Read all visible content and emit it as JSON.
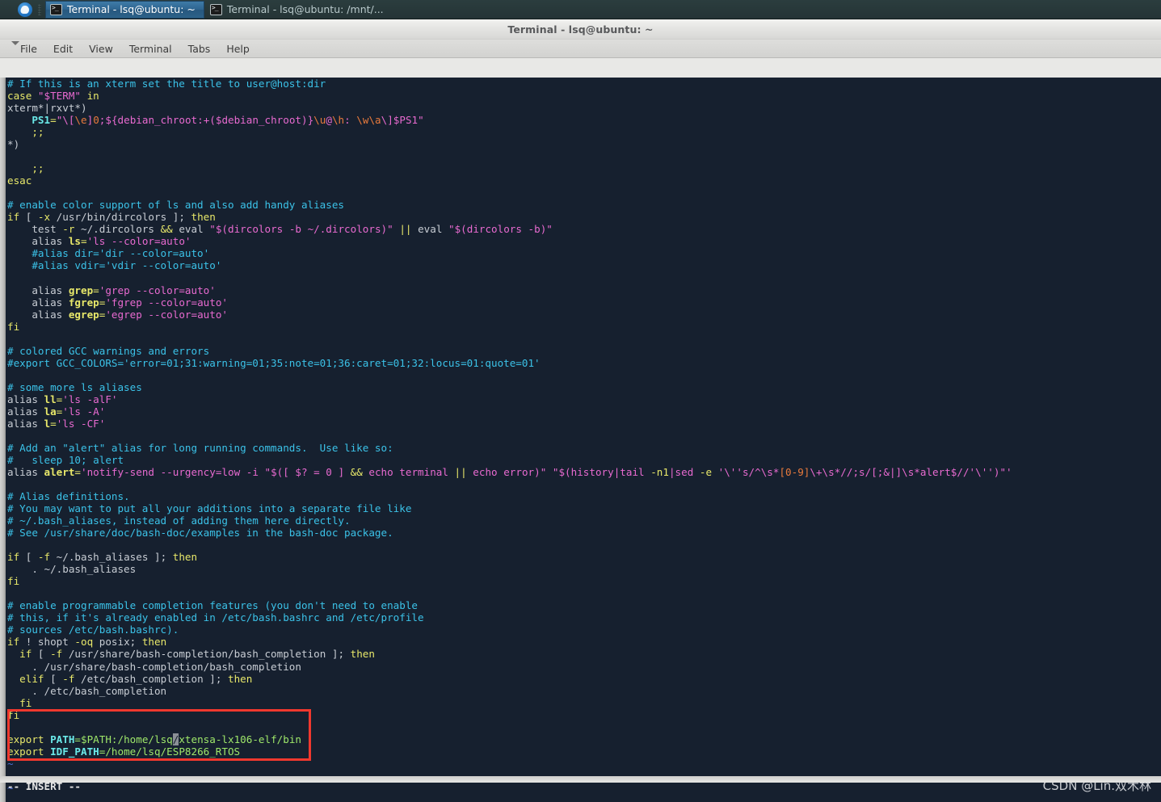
{
  "taskbar": {
    "launcher_icon": "ubuntu-launcher-icon",
    "handle_icon": "panel-drag-handle-icon",
    "tasks": [
      {
        "label": "Terminal - lsq@ubuntu: ~",
        "icon": "terminal-icon",
        "active": true
      },
      {
        "label": "Terminal - lsq@ubuntu: /mnt/...",
        "icon": "terminal-icon",
        "active": false
      }
    ]
  },
  "window": {
    "title": "Terminal - lsq@ubuntu: ~",
    "menu_caret_icon": "chevron-down-icon",
    "menu": [
      {
        "label": "File"
      },
      {
        "label": "Edit"
      },
      {
        "label": "View"
      },
      {
        "label": "Terminal"
      },
      {
        "label": "Tabs"
      },
      {
        "label": "Help"
      }
    ]
  },
  "terminal": {
    "status_line": "-- INSERT --",
    "watermark": "CSDN @Lin.双木林",
    "cursor_char": "/",
    "colors": {
      "background": "#16202f",
      "comment": "#3bc2e8",
      "statement": "#e8e86a",
      "string": "#e86ad0",
      "constant": "#e87a3c",
      "identifier": "#6ae8e8",
      "normal": "#c8cdd4",
      "tilde": "#4b6fd4",
      "annotation": "#f0382e",
      "cursor": "#8b8f96"
    },
    "lines": [
      [
        {
          "t": "# If this is an xterm set the title to user@host:dir",
          "c": "c-comment"
        }
      ],
      [
        {
          "t": "case ",
          "c": "c-stmt"
        },
        {
          "t": "\"$TERM\"",
          "c": "c-string"
        },
        {
          "t": " in",
          "c": "c-stmt"
        }
      ],
      [
        {
          "t": "xterm*|rxvt*)",
          "c": "c-ident"
        }
      ],
      [
        {
          "t": "    ",
          "c": "c-ident"
        },
        {
          "t": "PS1",
          "c": "c-var"
        },
        {
          "t": "=",
          "c": "c-op"
        },
        {
          "t": "\"\\[",
          "c": "c-string"
        },
        {
          "t": "\\e",
          "c": "c-special"
        },
        {
          "t": "]",
          "c": "c-string"
        },
        {
          "t": "0",
          "c": "c-const"
        },
        {
          "t": ";${debian_chroot:+($debian_chroot)}",
          "c": "c-string"
        },
        {
          "t": "\\u",
          "c": "c-special"
        },
        {
          "t": "@",
          "c": "c-string"
        },
        {
          "t": "\\h",
          "c": "c-special"
        },
        {
          "t": ": ",
          "c": "c-string"
        },
        {
          "t": "\\w",
          "c": "c-special"
        },
        {
          "t": "\\a",
          "c": "c-special"
        },
        {
          "t": "\\]",
          "c": "c-string"
        },
        {
          "t": "$PS1\"",
          "c": "c-string"
        }
      ],
      [
        {
          "t": "    ;;",
          "c": "c-stmt"
        }
      ],
      [
        {
          "t": "*)",
          "c": "c-ident"
        }
      ],
      [
        {
          "t": "",
          "c": "c-ident"
        }
      ],
      [
        {
          "t": "    ;;",
          "c": "c-stmt"
        }
      ],
      [
        {
          "t": "esac",
          "c": "c-stmt"
        }
      ],
      [
        {
          "t": "",
          "c": "c-ident"
        }
      ],
      [
        {
          "t": "# enable color support of ls and also add handy aliases",
          "c": "c-comment"
        }
      ],
      [
        {
          "t": "if",
          "c": "c-stmt"
        },
        {
          "t": " [ ",
          "c": "c-ident"
        },
        {
          "t": "-x",
          "c": "c-stmt"
        },
        {
          "t": " /usr/bin/dircolors ]; ",
          "c": "c-ident"
        },
        {
          "t": "then",
          "c": "c-stmt"
        }
      ],
      [
        {
          "t": "    test ",
          "c": "c-ident"
        },
        {
          "t": "-r",
          "c": "c-stmt"
        },
        {
          "t": " ~/.dircolors ",
          "c": "c-ident"
        },
        {
          "t": "&&",
          "c": "c-op"
        },
        {
          "t": " eval ",
          "c": "c-ident"
        },
        {
          "t": "\"$(dircolors -b ~/.dircolors)\"",
          "c": "c-string"
        },
        {
          "t": " ",
          "c": "c-ident"
        },
        {
          "t": "||",
          "c": "c-op"
        },
        {
          "t": " eval ",
          "c": "c-ident"
        },
        {
          "t": "\"$(dircolors -b)\"",
          "c": "c-string"
        }
      ],
      [
        {
          "t": "    alias ",
          "c": "c-ident"
        },
        {
          "t": "ls",
          "c": "c-func"
        },
        {
          "t": "=",
          "c": "c-op"
        },
        {
          "t": "'ls --color=auto'",
          "c": "c-string"
        }
      ],
      [
        {
          "t": "    #alias dir='dir --color=auto'",
          "c": "c-comment"
        }
      ],
      [
        {
          "t": "    #alias vdir='vdir --color=auto'",
          "c": "c-comment"
        }
      ],
      [
        {
          "t": "",
          "c": "c-ident"
        }
      ],
      [
        {
          "t": "    alias ",
          "c": "c-ident"
        },
        {
          "t": "grep",
          "c": "c-func"
        },
        {
          "t": "=",
          "c": "c-op"
        },
        {
          "t": "'grep --color=auto'",
          "c": "c-string"
        }
      ],
      [
        {
          "t": "    alias ",
          "c": "c-ident"
        },
        {
          "t": "fgrep",
          "c": "c-func"
        },
        {
          "t": "=",
          "c": "c-op"
        },
        {
          "t": "'fgrep --color=auto'",
          "c": "c-string"
        }
      ],
      [
        {
          "t": "    alias ",
          "c": "c-ident"
        },
        {
          "t": "egrep",
          "c": "c-func"
        },
        {
          "t": "=",
          "c": "c-op"
        },
        {
          "t": "'egrep --color=auto'",
          "c": "c-string"
        }
      ],
      [
        {
          "t": "fi",
          "c": "c-stmt"
        }
      ],
      [
        {
          "t": "",
          "c": "c-ident"
        }
      ],
      [
        {
          "t": "# colored GCC warnings and errors",
          "c": "c-comment"
        }
      ],
      [
        {
          "t": "#export GCC_COLORS='error=01;31:warning=01;35:note=01;36:caret=01;32:locus=01:quote=01'",
          "c": "c-comment"
        }
      ],
      [
        {
          "t": "",
          "c": "c-ident"
        }
      ],
      [
        {
          "t": "# some more ls aliases",
          "c": "c-comment"
        }
      ],
      [
        {
          "t": "alias ",
          "c": "c-ident"
        },
        {
          "t": "ll",
          "c": "c-func"
        },
        {
          "t": "=",
          "c": "c-op"
        },
        {
          "t": "'ls -alF'",
          "c": "c-string"
        }
      ],
      [
        {
          "t": "alias ",
          "c": "c-ident"
        },
        {
          "t": "la",
          "c": "c-func"
        },
        {
          "t": "=",
          "c": "c-op"
        },
        {
          "t": "'ls -A'",
          "c": "c-string"
        }
      ],
      [
        {
          "t": "alias ",
          "c": "c-ident"
        },
        {
          "t": "l",
          "c": "c-func"
        },
        {
          "t": "=",
          "c": "c-op"
        },
        {
          "t": "'ls -CF'",
          "c": "c-string"
        }
      ],
      [
        {
          "t": "",
          "c": "c-ident"
        }
      ],
      [
        {
          "t": "# Add an \"alert\" alias for long running commands.  Use like so:",
          "c": "c-comment"
        }
      ],
      [
        {
          "t": "#   sleep 10; alert",
          "c": "c-comment"
        }
      ],
      [
        {
          "t": "alias ",
          "c": "c-ident"
        },
        {
          "t": "alert",
          "c": "c-func"
        },
        {
          "t": "=",
          "c": "c-op"
        },
        {
          "t": "'notify-send --urgency=low -i ",
          "c": "c-string"
        },
        {
          "t": "\"$([ $? = 0 ] ",
          "c": "c-string"
        },
        {
          "t": "&&",
          "c": "c-op"
        },
        {
          "t": " echo terminal ",
          "c": "c-string"
        },
        {
          "t": "||",
          "c": "c-op"
        },
        {
          "t": " echo error)\"",
          "c": "c-string"
        },
        {
          "t": " ",
          "c": "c-ident"
        },
        {
          "t": "\"$(history|tail ",
          "c": "c-string"
        },
        {
          "t": "-n1",
          "c": "c-stmt"
        },
        {
          "t": "|sed ",
          "c": "c-string"
        },
        {
          "t": "-e",
          "c": "c-stmt"
        },
        {
          "t": " '\\''s/^\\s*",
          "c": "c-string"
        },
        {
          "t": "[0-9]",
          "c": "c-const"
        },
        {
          "t": "\\+\\s*//;s/[;&|]\\s*alert$//'\\''",
          "c": "c-string"
        },
        {
          "t": ")\"'",
          "c": "c-string"
        }
      ],
      [
        {
          "t": "",
          "c": "c-ident"
        }
      ],
      [
        {
          "t": "# Alias definitions.",
          "c": "c-comment"
        }
      ],
      [
        {
          "t": "# You may want to put all your additions into a separate file like",
          "c": "c-comment"
        }
      ],
      [
        {
          "t": "# ~/.bash_aliases, instead of adding them here directly.",
          "c": "c-comment"
        }
      ],
      [
        {
          "t": "# See /usr/share/doc/bash-doc/examples in the bash-doc package.",
          "c": "c-comment"
        }
      ],
      [
        {
          "t": "",
          "c": "c-ident"
        }
      ],
      [
        {
          "t": "if",
          "c": "c-stmt"
        },
        {
          "t": " [ ",
          "c": "c-ident"
        },
        {
          "t": "-f",
          "c": "c-stmt"
        },
        {
          "t": " ~/.bash_aliases ]; ",
          "c": "c-ident"
        },
        {
          "t": "then",
          "c": "c-stmt"
        }
      ],
      [
        {
          "t": "    . ~/.bash_aliases",
          "c": "c-ident"
        }
      ],
      [
        {
          "t": "fi",
          "c": "c-stmt"
        }
      ],
      [
        {
          "t": "",
          "c": "c-ident"
        }
      ],
      [
        {
          "t": "# enable programmable completion features (you don't need to enable",
          "c": "c-comment"
        }
      ],
      [
        {
          "t": "# this, if it's already enabled in /etc/bash.bashrc and /etc/profile",
          "c": "c-comment"
        }
      ],
      [
        {
          "t": "# sources /etc/bash.bashrc).",
          "c": "c-comment"
        }
      ],
      [
        {
          "t": "if",
          "c": "c-stmt"
        },
        {
          "t": " ! shopt ",
          "c": "c-ident"
        },
        {
          "t": "-oq",
          "c": "c-stmt"
        },
        {
          "t": " posix; ",
          "c": "c-ident"
        },
        {
          "t": "then",
          "c": "c-stmt"
        }
      ],
      [
        {
          "t": "  ",
          "c": "c-ident"
        },
        {
          "t": "if",
          "c": "c-stmt"
        },
        {
          "t": " [ ",
          "c": "c-ident"
        },
        {
          "t": "-f",
          "c": "c-stmt"
        },
        {
          "t": " /usr/share/bash-completion/bash_completion ]; ",
          "c": "c-ident"
        },
        {
          "t": "then",
          "c": "c-stmt"
        }
      ],
      [
        {
          "t": "    . /usr/share/bash-completion/bash_completion",
          "c": "c-ident"
        }
      ],
      [
        {
          "t": "  ",
          "c": "c-ident"
        },
        {
          "t": "elif",
          "c": "c-stmt"
        },
        {
          "t": " [ ",
          "c": "c-ident"
        },
        {
          "t": "-f",
          "c": "c-stmt"
        },
        {
          "t": " /etc/bash_completion ]; ",
          "c": "c-ident"
        },
        {
          "t": "then",
          "c": "c-stmt"
        }
      ],
      [
        {
          "t": "    . /etc/bash_completion",
          "c": "c-ident"
        }
      ],
      [
        {
          "t": "  fi",
          "c": "c-stmt"
        }
      ],
      [
        {
          "t": "fi",
          "c": "c-stmt"
        }
      ],
      [
        {
          "t": "",
          "c": "c-ident"
        }
      ],
      [
        {
          "t": "export ",
          "c": "c-stmt"
        },
        {
          "t": "PATH",
          "c": "c-var"
        },
        {
          "t": "=$PATH:/home/lsq",
          "c": "c-green"
        },
        {
          "t": "/",
          "c": "cursor",
          "cursor": true
        },
        {
          "t": "xtensa-lx106-elf/bin",
          "c": "c-green"
        }
      ],
      [
        {
          "t": "export ",
          "c": "c-stmt"
        },
        {
          "t": "IDF_PATH",
          "c": "c-var"
        },
        {
          "t": "=/home/lsq/ESP8266_RTOS",
          "c": "c-green"
        }
      ],
      [
        {
          "t": "~",
          "c": "tilde"
        }
      ],
      [
        {
          "t": "",
          "c": "c-ident"
        }
      ],
      [
        {
          "t": "~",
          "c": "tilde"
        }
      ]
    ]
  }
}
